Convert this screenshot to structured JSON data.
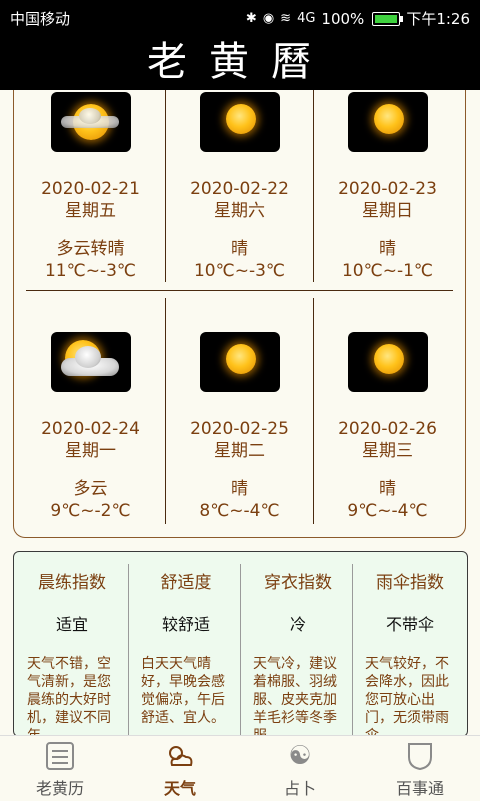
{
  "status_bar": {
    "carrier": "中国移动",
    "signal": "4G",
    "battery": "100%",
    "time": "下午1:26"
  },
  "title": "老黄曆",
  "forecast": [
    {
      "date": "2020-02-21",
      "weekday": "星期五",
      "condition": "多云转晴",
      "temp": "11℃~-3℃",
      "icon": "partly-sunny-icon"
    },
    {
      "date": "2020-02-22",
      "weekday": "星期六",
      "condition": "晴",
      "temp": "10℃~-3℃",
      "icon": "sun-icon"
    },
    {
      "date": "2020-02-23",
      "weekday": "星期日",
      "condition": "晴",
      "temp": "10℃~-1℃",
      "icon": "sun-icon"
    },
    {
      "date": "2020-02-24",
      "weekday": "星期一",
      "condition": "多云",
      "temp": "9℃~-2℃",
      "icon": "cloudy-icon"
    },
    {
      "date": "2020-02-25",
      "weekday": "星期二",
      "condition": "晴",
      "temp": "8℃~-4℃",
      "icon": "sun-icon"
    },
    {
      "date": "2020-02-26",
      "weekday": "星期三",
      "condition": "晴",
      "temp": "9℃~-4℃",
      "icon": "sun-icon"
    }
  ],
  "indices": [
    {
      "title": "晨练指数",
      "value": "适宜",
      "desc": "天气不错，空气清新，是您晨练的大好时机，建议不同年"
    },
    {
      "title": "舒适度",
      "value": "较舒适",
      "desc": "白天天气晴好，早晚会感觉偏凉，午后舒适、宜人。"
    },
    {
      "title": "穿衣指数",
      "value": "冷",
      "desc": "天气冷，建议着棉服、羽绒服、皮夹克加羊毛衫等冬季服"
    },
    {
      "title": "雨伞指数",
      "value": "不带伞",
      "desc": "天气较好，不会降水，因此您可放心出门，无须带雨伞。"
    }
  ],
  "nav": [
    {
      "label": "老黄历",
      "icon": "almanac-icon",
      "active": false
    },
    {
      "label": "天气",
      "icon": "weather-icon",
      "active": true
    },
    {
      "label": "占卜",
      "icon": "yin-yang-icon",
      "active": false
    },
    {
      "label": "百事通",
      "icon": "shield-icon",
      "active": false
    }
  ],
  "colors": {
    "accent": "#7b3f10",
    "index_bg": "#eefaee",
    "background": "#fbfaf1"
  }
}
